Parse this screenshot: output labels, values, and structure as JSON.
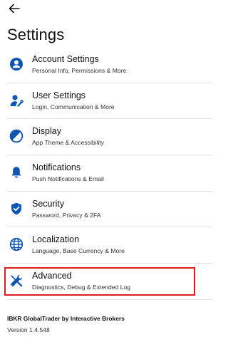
{
  "header": {
    "back_icon": "arrow-left-icon",
    "title": "Settings"
  },
  "colors": {
    "accent": "#0d56b0",
    "highlight": "#e01b24",
    "divider": "#e1e1e1"
  },
  "items": [
    {
      "label": "Account Settings",
      "sub": "Personal Info, Permissions & More",
      "icon": "user-circle-icon"
    },
    {
      "label": "User Settings",
      "sub": "Login, Communication & More",
      "icon": "user-settings-icon"
    },
    {
      "label": "Display",
      "sub": "App Theme & Accessibility",
      "icon": "display-theme-icon"
    },
    {
      "label": "Notifications",
      "sub": "Push Notifications & Email",
      "icon": "bell-icon"
    },
    {
      "label": "Security",
      "sub": "Password, Privacy & 2FA",
      "icon": "shield-check-icon"
    },
    {
      "label": "Localization",
      "sub": "Language, Base Currency & More",
      "icon": "globe-icon"
    },
    {
      "label": "Advanced",
      "sub": "Diagnostics, Debug & Extended Log",
      "icon": "tools-icon"
    }
  ],
  "footer": {
    "app_name": "IBKR GlobalTrader by Interactive Brokers",
    "version": "Version 1.4.548"
  }
}
